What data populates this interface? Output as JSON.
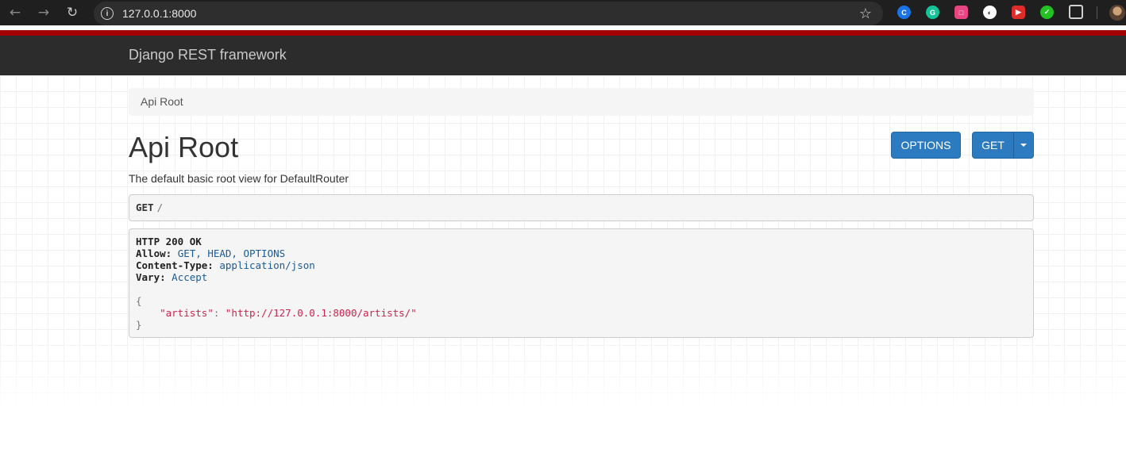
{
  "browser": {
    "url": "127.0.0.1:8000",
    "back_icon": "arrow-left-icon",
    "forward_icon": "arrow-right-icon",
    "reload_icon": "reload-icon",
    "extensions": [
      {
        "name": "extension-blue-icon",
        "color": "#1a73e8",
        "glyph": "C"
      },
      {
        "name": "grammarly-icon",
        "color": "#15c39a",
        "glyph": "G"
      },
      {
        "name": "extension-pink-icon",
        "color": "#e94583",
        "glyph": "□"
      },
      {
        "name": "extension-white-icon",
        "color": "#ffffff",
        "glyph": "◐"
      },
      {
        "name": "youtube-extension-icon",
        "color": "#e02b2b",
        "glyph": "▶"
      },
      {
        "name": "extension-green-icon",
        "color": "#22c222",
        "glyph": "👍"
      }
    ]
  },
  "navbar": {
    "brand": "Django REST framework",
    "accent_color": "#a30000"
  },
  "breadcrumb": {
    "items": [
      "Api Root"
    ]
  },
  "content": {
    "title": "Api Root",
    "description": "The default basic root view for DefaultRouter",
    "buttons": {
      "options": "OPTIONS",
      "get": "GET"
    },
    "request": {
      "method": "GET",
      "path": "/"
    },
    "response": {
      "status": "HTTP 200 OK",
      "headers": [
        {
          "key": "Allow:",
          "value": "GET, HEAD, OPTIONS"
        },
        {
          "key": "Content-Type:",
          "value": "application/json"
        },
        {
          "key": "Vary:",
          "value": "Accept"
        }
      ],
      "body_open": "{",
      "body_close": "}",
      "body": [
        {
          "key": "\"artists\"",
          "sep": ": ",
          "value": "\"http://127.0.0.1:8000/artists/\""
        }
      ]
    }
  },
  "colors": {
    "primary_button": "#2c7bc1",
    "navbar_bg": "#2c2c2c"
  }
}
